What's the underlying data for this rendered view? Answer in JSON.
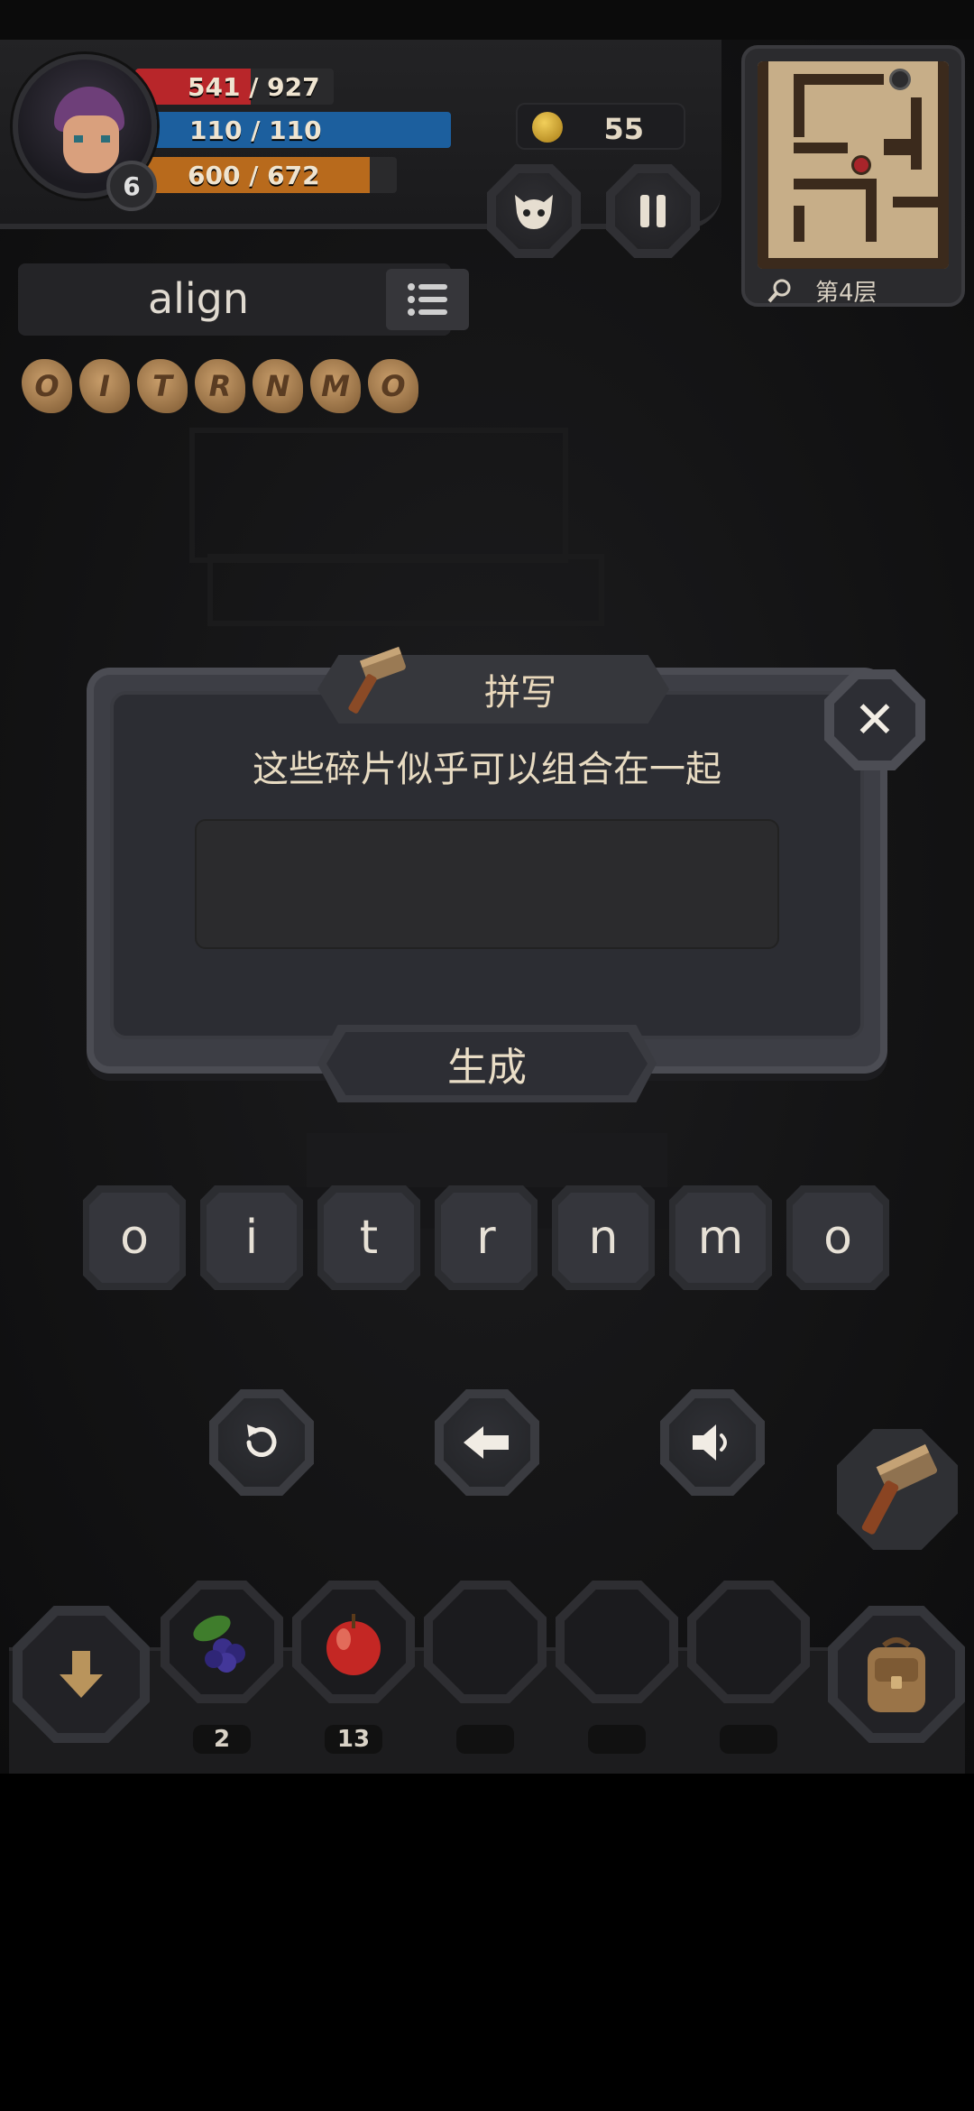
{
  "hud": {
    "level": "6",
    "hp": {
      "text": "541 / 927",
      "fraction": 0.583,
      "color": "#b8262a"
    },
    "mp": {
      "text": "110 / 110",
      "fraction": 1.0,
      "color": "#1c5f9e"
    },
    "xp": {
      "text": "600 / 672",
      "fraction": 0.893,
      "color": "#b86a1c"
    },
    "coins": "55"
  },
  "minimap": {
    "floor_label": "第4层"
  },
  "word": {
    "current": "align",
    "fragments": [
      "O",
      "I",
      "T",
      "R",
      "N",
      "M",
      "O"
    ]
  },
  "dialog": {
    "title": "拼写",
    "message": "这些碎片似乎可以组合在一起",
    "input_value": "",
    "generate_label": "生成"
  },
  "letters": [
    "o",
    "i",
    "t",
    "r",
    "n",
    "m",
    "o"
  ],
  "controls": {
    "reset_icon": "refresh-icon",
    "backspace_icon": "arrow-left-icon",
    "sound_icon": "speaker-icon"
  },
  "inventory": {
    "slots": [
      {
        "item": "berries",
        "count": "2"
      },
      {
        "item": "apple",
        "count": "13"
      },
      {
        "item": "",
        "count": ""
      },
      {
        "item": "",
        "count": ""
      },
      {
        "item": "",
        "count": ""
      }
    ]
  }
}
